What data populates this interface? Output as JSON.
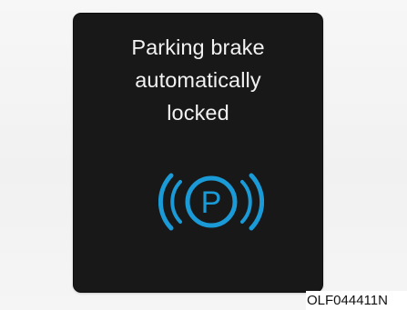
{
  "display": {
    "message_lines": [
      "Parking brake",
      "automatically",
      "locked"
    ],
    "indicator": {
      "icon": "parking-brake-icon",
      "letter": "P",
      "color": "#1a9ad6"
    },
    "background_color": "#181818",
    "text_color": "#f2f2f2"
  },
  "image_code": "OLF044411N"
}
